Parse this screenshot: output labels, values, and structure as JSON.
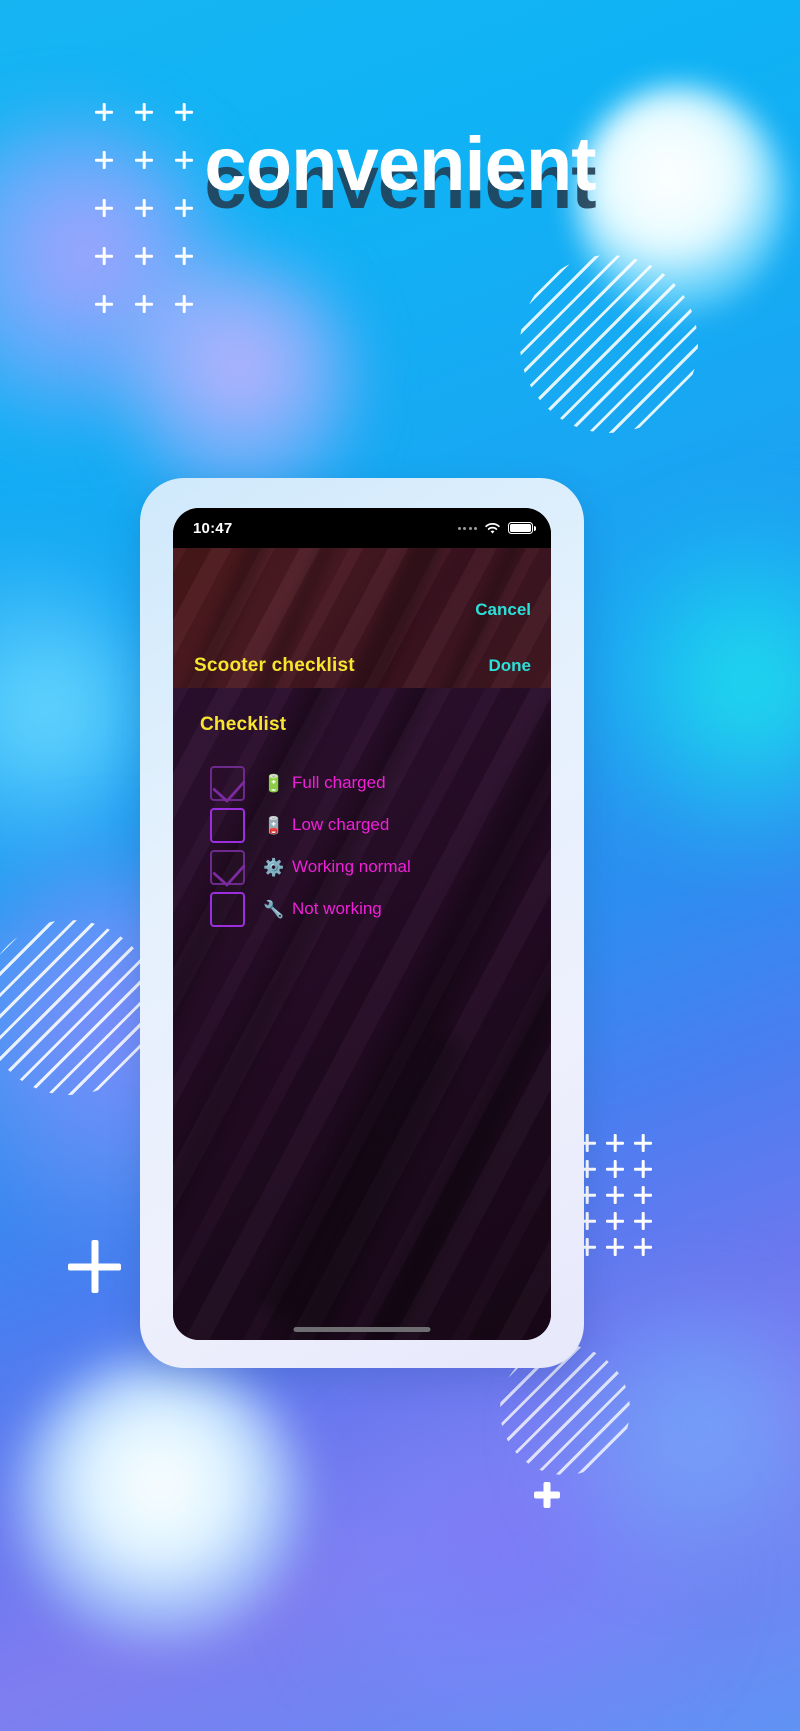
{
  "hero": {
    "headline": "convenient",
    "headline_shadow": "convenient",
    "bg_colors": {
      "cyan": "#17b4f2",
      "blue": "#2e8df0",
      "violet": "#7f7df0",
      "white": "#ffffff"
    },
    "decor": {
      "plus_icon": "plus-mark",
      "stripe_circle": "diagonal-striped-circle"
    }
  },
  "phone": {
    "bezel_color": "#e4f1fd",
    "status_bar": {
      "time": "10:47",
      "signal_dots_icon": "cellular-dots-icon",
      "wifi_icon": "wifi-icon",
      "battery_icon": "battery-full-icon"
    },
    "app": {
      "nav": {
        "cancel_label": "Cancel",
        "done_label": "Done",
        "title": "Scooter checklist",
        "accent_color": "#2ae0d8",
        "title_color": "#f7e52e",
        "background_color": "#4a1718"
      },
      "content": {
        "section_title": "Checklist",
        "section_title_color": "#f7e52e",
        "item_text_color": "#f020d8",
        "checkbox_color": "#9b2fe0",
        "background_color": "#230b24",
        "items": [
          {
            "label": "Full charged",
            "icon": "🔋",
            "icon_name": "battery-full-icon",
            "checked": true
          },
          {
            "label": "Low charged",
            "icon": "🪫",
            "icon_name": "battery-low-icon",
            "checked": false
          },
          {
            "label": "Working normal",
            "icon": "⚙️",
            "icon_name": "gear-icon",
            "checked": true
          },
          {
            "label": "Not working",
            "icon": "🔧",
            "icon_name": "wrench-icon",
            "checked": false
          }
        ]
      },
      "home_indicator": "home-indicator-bar"
    }
  }
}
